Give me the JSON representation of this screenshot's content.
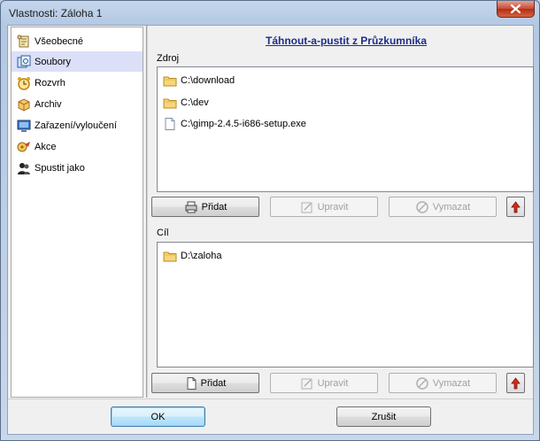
{
  "window": {
    "title": "Vlastnosti: Záloha 1"
  },
  "sidebar": {
    "items": [
      {
        "label": "Všeobecné",
        "icon": "scroll-icon",
        "selected": false
      },
      {
        "label": "Soubory",
        "icon": "files-icon",
        "selected": true
      },
      {
        "label": "Rozvrh",
        "icon": "alarm-clock-icon",
        "selected": false
      },
      {
        "label": "Archiv",
        "icon": "archive-box-icon",
        "selected": false
      },
      {
        "label": "Zařazení/vyloučení",
        "icon": "monitor-icon",
        "selected": false
      },
      {
        "label": "Akce",
        "icon": "actions-icon",
        "selected": false
      },
      {
        "label": "Spustit jako",
        "icon": "users-icon",
        "selected": false
      }
    ]
  },
  "panel": {
    "link": "Táhnout-a-pustit z Průzkumníka",
    "source": {
      "label": "Zdroj",
      "items": [
        {
          "text": "C:\\download",
          "icon": "folder-icon"
        },
        {
          "text": "C:\\dev",
          "icon": "folder-icon"
        },
        {
          "text": "C:\\gimp-2.4.5-i686-setup.exe",
          "icon": "file-icon"
        }
      ],
      "buttons": {
        "add": "Přidat",
        "edit": "Upravit",
        "delete": "Vymazat"
      }
    },
    "target": {
      "label": "Cíl",
      "items": [
        {
          "text": "D:\\zaloha",
          "icon": "folder-icon"
        }
      ],
      "buttons": {
        "add": "Přidat",
        "edit": "Upravit",
        "delete": "Vymazat"
      }
    }
  },
  "footer": {
    "ok": "OK",
    "cancel": "Zrušit"
  },
  "colors": {
    "accent": "#1c2e8c",
    "selection": "#dcdff8",
    "close": "#c64a32"
  }
}
